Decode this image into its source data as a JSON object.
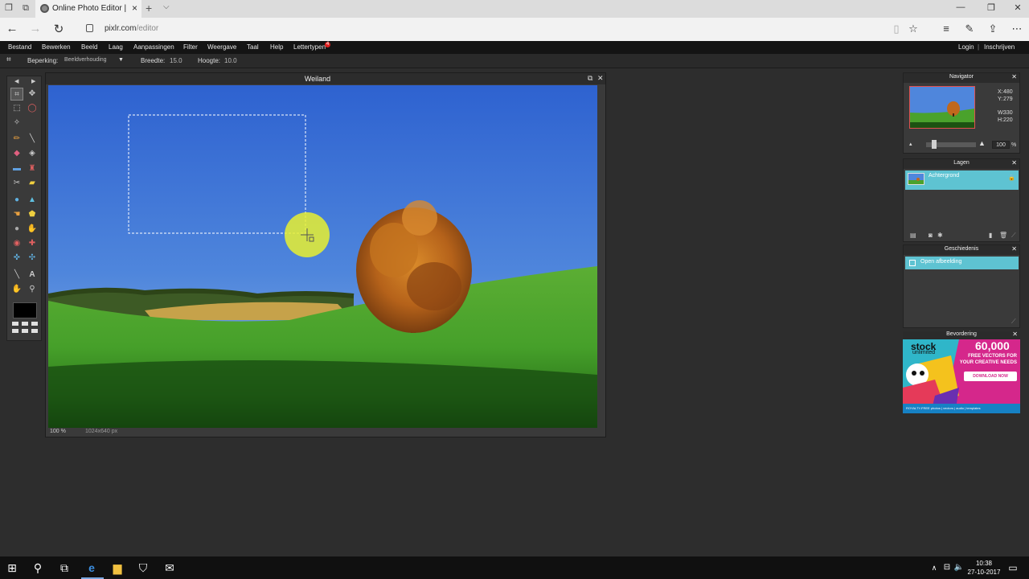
{
  "browser": {
    "tab_title": "Online Photo Editor | Pi",
    "url_host": "pixlr.com",
    "url_path": "/editor"
  },
  "menu": {
    "items": [
      "Bestand",
      "Bewerken",
      "Beeld",
      "Laag",
      "Aanpassingen",
      "Filter",
      "Weergave",
      "Taal",
      "Help",
      "Lettertypen"
    ],
    "lettertypen_badge": "4",
    "login": "Login",
    "separator": "|",
    "signup": "Inschrijven"
  },
  "options": {
    "constraint_label": "Beperking:",
    "constraint_value": "Beeldverhouding",
    "width_label": "Breedte:",
    "width_value": "15.0",
    "height_label": "Hoogte:",
    "height_value": "10.0"
  },
  "document": {
    "title": "Weiland",
    "zoom": "100",
    "zoom_unit": "%",
    "dimensions": "1024x640 px"
  },
  "navigator": {
    "title": "Navigator",
    "x_label": "X:",
    "x_value": "480",
    "y_label": "Y:",
    "y_value": "279",
    "w_label": "W:",
    "w_value": "330",
    "h_label": "H:",
    "h_value": "220",
    "zoom_value": "100",
    "zoom_unit": "%"
  },
  "layers": {
    "title": "Lagen",
    "items": [
      "Achtergrond"
    ]
  },
  "history": {
    "title": "Geschiedenis",
    "items": [
      "Open afbeelding"
    ]
  },
  "ad": {
    "title": "Bevordering",
    "brand": "stock",
    "brand_sub": "unlimited",
    "headline": "60,000",
    "line1": "FREE VECTORS FOR",
    "line2": "YOUR CREATIVE NEEDS",
    "cta": "DOWNLOAD NOW",
    "footer": "ROYALTY-FREE  photos | vectors | audio | templates"
  },
  "taskbar": {
    "time": "10:38",
    "date": "27-10-2017"
  },
  "colors": {
    "accent_teal": "#5ec3d2",
    "panel_bg": "#3a3a3a",
    "app_bg": "#2d2d2d"
  }
}
